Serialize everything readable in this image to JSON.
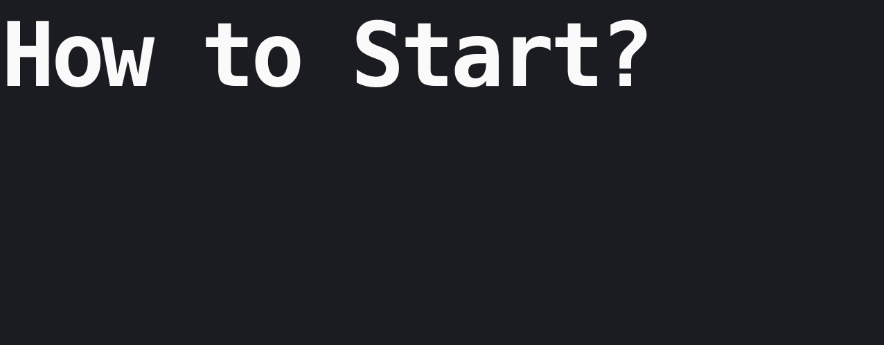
{
  "heading": {
    "text": "How to Start?"
  },
  "colors": {
    "background": "#1b1c21",
    "text": "#fafafa"
  }
}
